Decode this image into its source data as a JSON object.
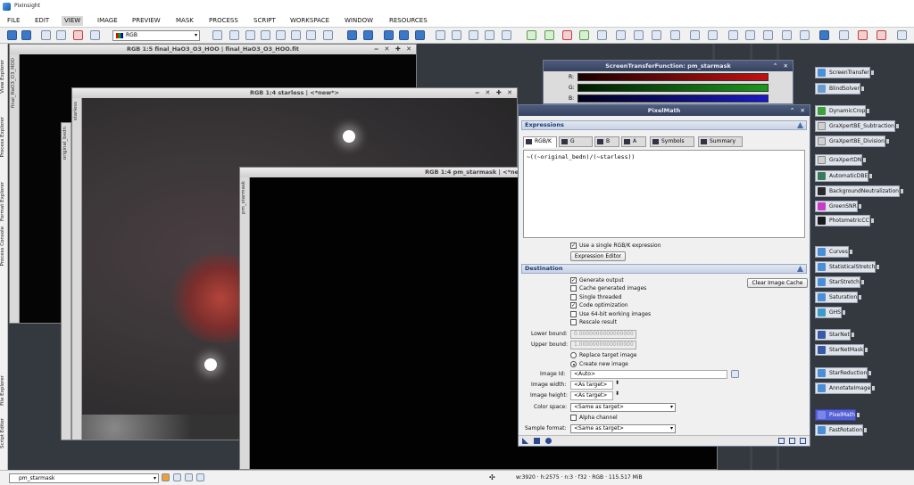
{
  "app": {
    "title": "PixInsight"
  },
  "menu": [
    "FILE",
    "EDIT",
    "VIEW",
    "IMAGE",
    "PREVIEW",
    "MASK",
    "PROCESS",
    "SCRIPT",
    "WORKSPACE",
    "WINDOW",
    "RESOURCES"
  ],
  "menu_active": "VIEW",
  "toolbar": {
    "channel_select": "RGB"
  },
  "left_tabs": [
    "View Explorer",
    "Process Explorer",
    "Format Explorer",
    "Process Console",
    "File Explorer",
    "Script Editor"
  ],
  "windows": {
    "w1": {
      "title": "RGB 1:5 final_HaO3_O3_HOO | final_HaO3_O3_HOO.fit",
      "side": "final_HaO3_O3_HOO"
    },
    "w2": {
      "title": "RGB 1:4 starless | <*new*>",
      "side": "starless"
    },
    "w3": {
      "side": "original_bedn"
    },
    "w4": {
      "title": "RGB 1:4 pm_starmask | <*new*>",
      "side": "pm_starmask"
    }
  },
  "stf": {
    "title": "ScreenTransferFunction: pm_starmask",
    "channels": [
      "R:",
      "G:",
      "B:"
    ],
    "colors": [
      "#c41010",
      "#1a9a1a",
      "#1a1ac4"
    ]
  },
  "pixelmath": {
    "title": "PixelMath",
    "expressions_header": "Expressions",
    "tabs": [
      "RGB/K",
      "G",
      "B",
      "A",
      "Symbols",
      "Summary"
    ],
    "expression": "~((~original_bedn)/(~starless))",
    "use_single": "Use a single RGB/K expression",
    "use_single_checked": true,
    "expression_editor": "Expression Editor",
    "destination_header": "Destination",
    "options": [
      {
        "label": "Generate output",
        "checked": true
      },
      {
        "label": "Cache generated images",
        "checked": false
      },
      {
        "label": "Single threaded",
        "checked": false
      },
      {
        "label": "Code optimization",
        "checked": true
      },
      {
        "label": "Use 64-bit working images",
        "checked": false
      },
      {
        "label": "Rescale result",
        "checked": false
      }
    ],
    "clear_cache": "Clear Image Cache",
    "lower_bound_label": "Lower bound:",
    "lower_bound": "0.0000000000000000",
    "upper_bound_label": "Upper bound:",
    "upper_bound": "1.0000000000000000",
    "replace_target": "Replace target image",
    "create_new": "Create new image",
    "image_id_label": "Image Id:",
    "image_id": "<Auto>",
    "image_width_label": "Image width:",
    "image_width": "<As target>",
    "image_height_label": "Image height:",
    "image_height": "<As target>",
    "color_space_label": "Color space:",
    "color_space": "<Same as target>",
    "alpha_channel": "Alpha channel",
    "sample_format_label": "Sample format:",
    "sample_format": "<Same as target>"
  },
  "processes": [
    {
      "label": "ScreenTransfer",
      "icon": "#4a8ed8"
    },
    {
      "label": "BlindSolver",
      "icon": "#6a9cd0"
    },
    {
      "label": "DynamicCrop",
      "icon": "#3da03d"
    },
    {
      "label": "GraXpertBE_Subtraction",
      "icon": "#d0d0d0"
    },
    {
      "label": "GraXpertBE_Division",
      "icon": "#d0d0d0"
    },
    {
      "label": "GraXpertDN",
      "icon": "#d0d0d0"
    },
    {
      "label": "AutomaticDBE",
      "icon": "#3a7a5a"
    },
    {
      "label": "BackgroundNeutralization",
      "icon": "#2a2a2a"
    },
    {
      "label": "GreenSNR",
      "icon": "#c83ac8"
    },
    {
      "label": "PhotometricCC",
      "icon": "#1a1a1a"
    },
    {
      "label": "Curves",
      "icon": "#4a8ed8"
    },
    {
      "label": "StatisticalStretch",
      "icon": "#4a8ed8"
    },
    {
      "label": "StarStretch",
      "icon": "#4a8ed8"
    },
    {
      "label": "Saturation",
      "icon": "#4a8ed8"
    },
    {
      "label": "GHS",
      "icon": "#3a9ac8"
    },
    {
      "label": "StarNet",
      "icon": "#3a5aa8"
    },
    {
      "label": "StarNetMask",
      "icon": "#3a5aa8"
    },
    {
      "label": "StarReduction",
      "icon": "#4a8ed8"
    },
    {
      "label": "AnnotateImage",
      "icon": "#4a8ed8"
    },
    {
      "label": "PixelMath",
      "icon": "#7a86e8"
    },
    {
      "label": "FastRotation",
      "icon": "#4a8ed8"
    }
  ],
  "status": {
    "view_select": "pm_starmask",
    "info": "w:3920 · h:2575 · n:3 · f32 · RGB · 115.517 MiB"
  }
}
